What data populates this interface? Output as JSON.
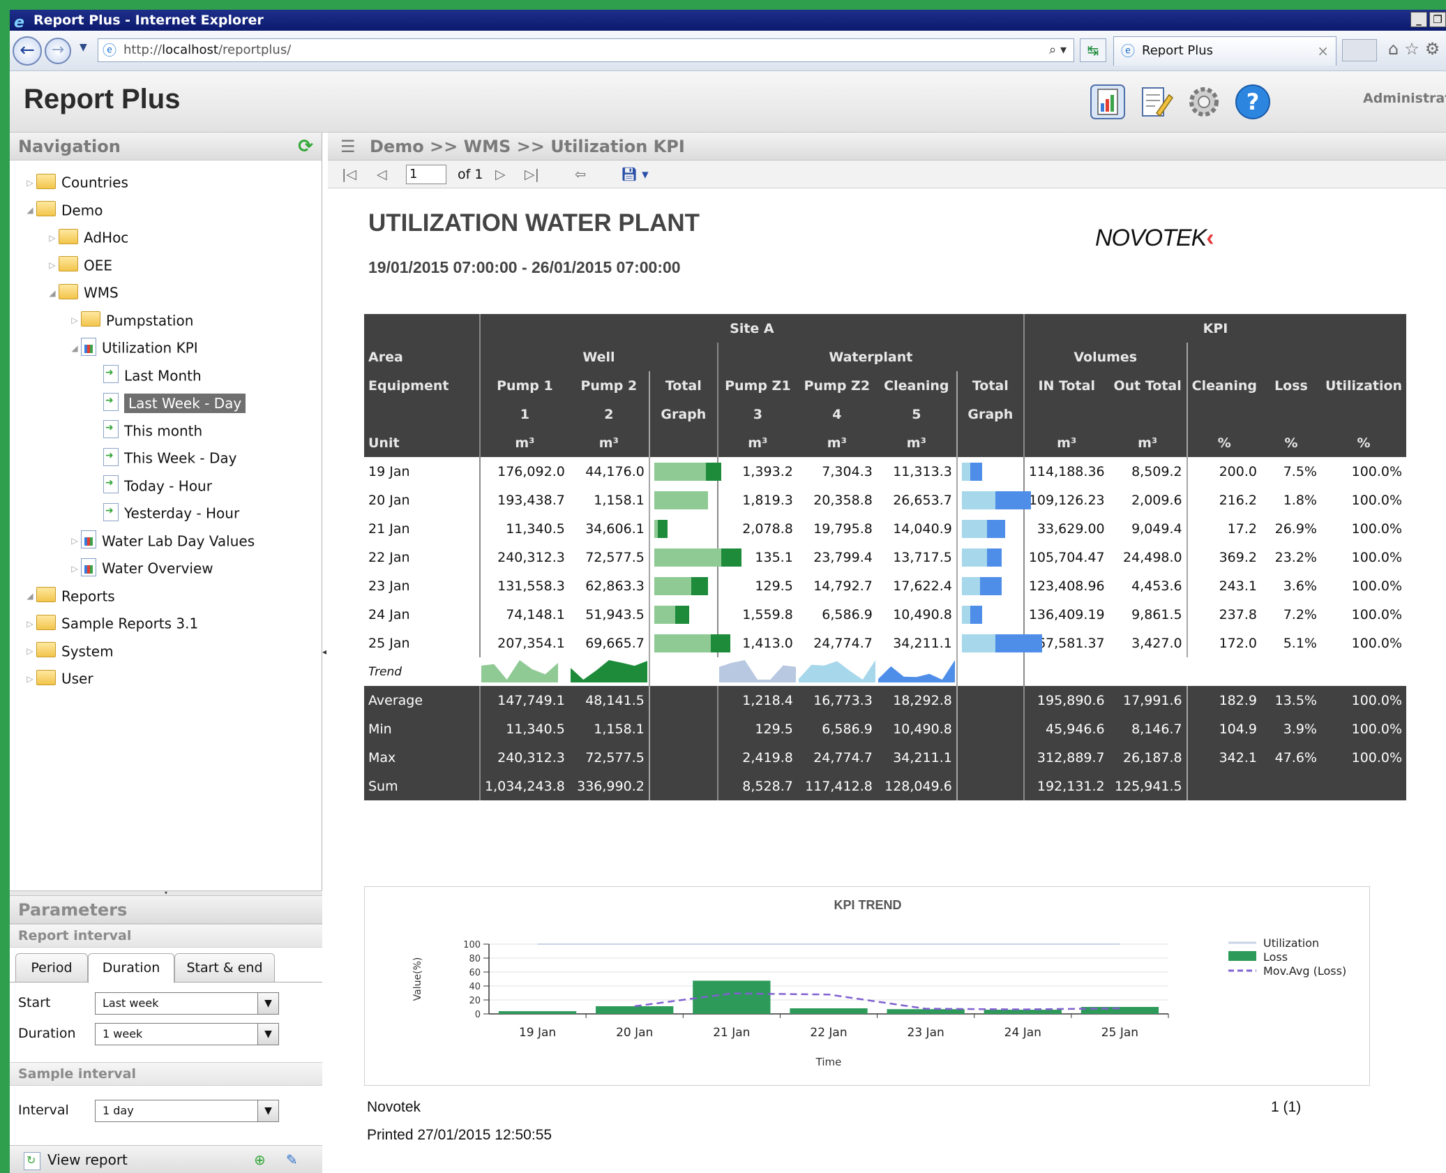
{
  "window": {
    "title": "Report Plus - Internet Explorer"
  },
  "browser": {
    "url_prefix": "http://",
    "url_host": "localhost",
    "url_path": "/reportplus/",
    "tab_title": "Report Plus"
  },
  "app": {
    "title": "Report Plus",
    "user": "Administrato"
  },
  "navigation": {
    "title": "Navigation",
    "tree": [
      {
        "label": "Countries",
        "icon": "folder",
        "level": 0,
        "expanded": false
      },
      {
        "label": "Demo",
        "icon": "folder",
        "level": 0,
        "expanded": true
      },
      {
        "label": "AdHoc",
        "icon": "folder",
        "level": 1,
        "expanded": false
      },
      {
        "label": "OEE",
        "icon": "folder",
        "level": 1,
        "expanded": false
      },
      {
        "label": "WMS",
        "icon": "folder",
        "level": 1,
        "expanded": true
      },
      {
        "label": "Pumpstation",
        "icon": "folder",
        "level": 2,
        "expanded": false
      },
      {
        "label": "Utilization KPI",
        "icon": "report",
        "level": 2,
        "expanded": true
      },
      {
        "label": "Last Month",
        "icon": "link",
        "level": 3
      },
      {
        "label": "Last Week - Day",
        "icon": "link",
        "level": 3,
        "selected": true
      },
      {
        "label": "This month",
        "icon": "link",
        "level": 3
      },
      {
        "label": "This Week - Day",
        "icon": "link",
        "level": 3
      },
      {
        "label": "Today - Hour",
        "icon": "link",
        "level": 3
      },
      {
        "label": "Yesterday - Hour",
        "icon": "link",
        "level": 3
      },
      {
        "label": "Water Lab Day Values",
        "icon": "report",
        "level": 2,
        "expanded": false
      },
      {
        "label": "Water Overview",
        "icon": "report",
        "level": 2,
        "expanded": false
      },
      {
        "label": "Reports",
        "icon": "folder",
        "level": 0,
        "expanded": true
      },
      {
        "label": "Sample Reports 3.1",
        "icon": "folder",
        "level": 0,
        "expanded": false
      },
      {
        "label": "System",
        "icon": "folder",
        "level": 0,
        "expanded": false
      },
      {
        "label": "User",
        "icon": "folder",
        "level": 0,
        "expanded": false
      }
    ]
  },
  "parameters": {
    "title": "Parameters",
    "report_interval": "Report interval",
    "tabs": [
      "Period",
      "Duration",
      "Start & end"
    ],
    "active_tab": "Duration",
    "start_label": "Start",
    "start_value": "Last week",
    "duration_label": "Duration",
    "duration_value": "1 week",
    "sample_interval": "Sample interval",
    "interval_label": "Interval",
    "interval_value": "1 day",
    "view_report": "View report"
  },
  "report": {
    "breadcrumb": "Demo >> WMS >> Utilization KPI",
    "page": "1",
    "page_of": "of 1",
    "title": "UTILIZATION WATER PLANT",
    "range": "19/01/2015 07:00:00 - 26/01/2015 07:00:00",
    "logo": "NOVOTEK",
    "footer_company": "Novotek",
    "footer_printed": "Printed 27/01/2015 12:50:55",
    "footer_page": "1 (1)"
  },
  "table": {
    "group_site": "Site A",
    "group_kpi": "KPI",
    "area_label": "Area",
    "equipment_label": "Equipment",
    "unit_label": "Unit",
    "well_label": "Well",
    "waterplant_label": "Waterplant",
    "volumes_label": "Volumes",
    "columns": [
      {
        "name": "Pump 1",
        "num": "1",
        "unit": "m³"
      },
      {
        "name": "Pump 2",
        "num": "2",
        "unit": "m³"
      },
      {
        "name": "Total",
        "num": "Graph",
        "unit": ""
      },
      {
        "name": "Pump Z1",
        "num": "3",
        "unit": "m³"
      },
      {
        "name": "Pump Z2",
        "num": "4",
        "unit": "m³"
      },
      {
        "name": "Cleaning",
        "num": "5",
        "unit": "m³"
      },
      {
        "name": "Total",
        "num": "Graph",
        "unit": ""
      },
      {
        "name": "IN Total",
        "num": "",
        "unit": "m³"
      },
      {
        "name": "Out Total",
        "num": "",
        "unit": "m³"
      },
      {
        "name": "Cleaning",
        "num": "",
        "unit": "%"
      },
      {
        "name": "Loss",
        "num": "",
        "unit": "%"
      },
      {
        "name": "Utilization",
        "num": "",
        "unit": "%"
      }
    ],
    "rows": [
      {
        "day": "19 Jan",
        "p1": "176,092.0",
        "p2": "44,176.0",
        "wlt": 0.62,
        "wdk": 0.18,
        "z1": "1,393.2",
        "z2": "7,304.3",
        "cl": "11,313.3",
        "plt": 0.1,
        "pdk": 0.14,
        "in": "114,188.36",
        "out": "8,509.2",
        "kcl": "200.0",
        "loss": "7.5%",
        "util": "100.0%"
      },
      {
        "day": "20 Jan",
        "p1": "193,438.7",
        "p2": "1,158.1",
        "wlt": 0.64,
        "wdk": 0.0,
        "z1": "1,819.3",
        "z2": "20,358.8",
        "cl": "26,653.7",
        "plt": 0.4,
        "pdk": 0.43,
        "in": "109,126.23",
        "out": "2,009.6",
        "kcl": "216.2",
        "loss": "1.8%",
        "util": "100.0%"
      },
      {
        "day": "21 Jan",
        "p1": "11,340.5",
        "p2": "34,606.1",
        "wlt": 0.04,
        "wdk": 0.12,
        "z1": "2,078.8",
        "z2": "19,795.8",
        "cl": "14,040.9",
        "plt": 0.3,
        "pdk": 0.22,
        "in": "33,629.00",
        "out": "9,049.4",
        "kcl": "17.2",
        "loss": "26.9%",
        "util": "100.0%"
      },
      {
        "day": "22 Jan",
        "p1": "240,312.3",
        "p2": "72,577.5",
        "wlt": 0.8,
        "wdk": 0.24,
        "z1": "135.1",
        "z2": "23,799.4",
        "cl": "13,717.5",
        "plt": 0.3,
        "pdk": 0.18,
        "in": "105,704.47",
        "out": "24,498.0",
        "kcl": "369.2",
        "loss": "23.2%",
        "util": "100.0%"
      },
      {
        "day": "23 Jan",
        "p1": "131,558.3",
        "p2": "62,863.3",
        "wlt": 0.44,
        "wdk": 0.2,
        "z1": "129.5",
        "z2": "14,792.7",
        "cl": "17,622.4",
        "plt": 0.22,
        "pdk": 0.26,
        "in": "123,408.96",
        "out": "4,453.6",
        "kcl": "243.1",
        "loss": "3.6%",
        "util": "100.0%"
      },
      {
        "day": "24 Jan",
        "p1": "74,148.1",
        "p2": "51,943.5",
        "wlt": 0.25,
        "wdk": 0.17,
        "z1": "1,559.8",
        "z2": "6,586.9",
        "cl": "10,490.8",
        "plt": 0.1,
        "pdk": 0.14,
        "in": "136,409.19",
        "out": "9,861.5",
        "kcl": "237.8",
        "loss": "7.2%",
        "util": "100.0%"
      },
      {
        "day": "25 Jan",
        "p1": "207,354.1",
        "p2": "69,665.7",
        "wlt": 0.68,
        "wdk": 0.23,
        "z1": "1,413.0",
        "z2": "24,774.7",
        "cl": "34,211.1",
        "plt": 0.4,
        "pdk": 0.56,
        "in": "67,581.37",
        "out": "3,427.0",
        "kcl": "172.0",
        "loss": "5.1%",
        "util": "100.0%"
      }
    ],
    "trend_label": "Trend",
    "stats": [
      {
        "label": "Average",
        "p1": "147,749.1",
        "p2": "48,141.5",
        "z1": "1,218.4",
        "z2": "16,773.3",
        "cl": "18,292.8",
        "in": "195,890.6",
        "out": "17,991.6",
        "kcl": "182.9",
        "loss": "13.5%",
        "util": "100.0%"
      },
      {
        "label": "Min",
        "p1": "11,340.5",
        "p2": "1,158.1",
        "z1": "129.5",
        "z2": "6,586.9",
        "cl": "10,490.8",
        "in": "45,946.6",
        "out": "8,146.7",
        "kcl": "104.9",
        "loss": "3.9%",
        "util": "100.0%"
      },
      {
        "label": "Max",
        "p1": "240,312.3",
        "p2": "72,577.5",
        "z1": "2,419.8",
        "z2": "24,774.7",
        "cl": "34,211.1",
        "in": "312,889.7",
        "out": "26,187.8",
        "kcl": "342.1",
        "loss": "47.6%",
        "util": "100.0%"
      },
      {
        "label": "Sum",
        "p1": "1,034,243.8",
        "p2": "336,990.2",
        "z1": "8,528.7",
        "z2": "117,412.8",
        "cl": "128,049.6",
        "in": "192,131.2",
        "out": "125,941.5",
        "kcl": "",
        "loss": "",
        "util": ""
      }
    ],
    "colors": {
      "header_bg": "#414141",
      "well_light": "#8fc994",
      "well_dark": "#1d8b3a",
      "plant_light": "#a6d7ea",
      "plant_dark": "#4f8ee8"
    }
  },
  "chart_data": {
    "type": "bar",
    "title": "KPI TREND",
    "xlabel": "Time",
    "ylabel": "Value(%)",
    "ylim": [
      0,
      100
    ],
    "yticks": [
      "0",
      "20",
      "40",
      "60",
      "80",
      "100"
    ],
    "categories": [
      "19 Jan",
      "20 Jan",
      "21 Jan",
      "22 Jan",
      "23 Jan",
      "24 Jan",
      "25 Jan"
    ],
    "series": [
      {
        "name": "Utilization",
        "kind": "line",
        "color": "#c9d3e6",
        "values": [
          100,
          100,
          100,
          100,
          100,
          100,
          100
        ]
      },
      {
        "name": "Loss",
        "kind": "bar",
        "color": "#2e9a5a",
        "values": [
          3.9,
          11.0,
          47.6,
          8.0,
          6.8,
          6.0,
          10.0
        ]
      },
      {
        "name": "Mov.Avg (Loss)",
        "kind": "dashed-line",
        "color": "#8060d0",
        "values": [
          null,
          11.0,
          29.3,
          27.8,
          7.4,
          6.4,
          8.0
        ]
      }
    ],
    "legend": "right",
    "grid": true
  }
}
